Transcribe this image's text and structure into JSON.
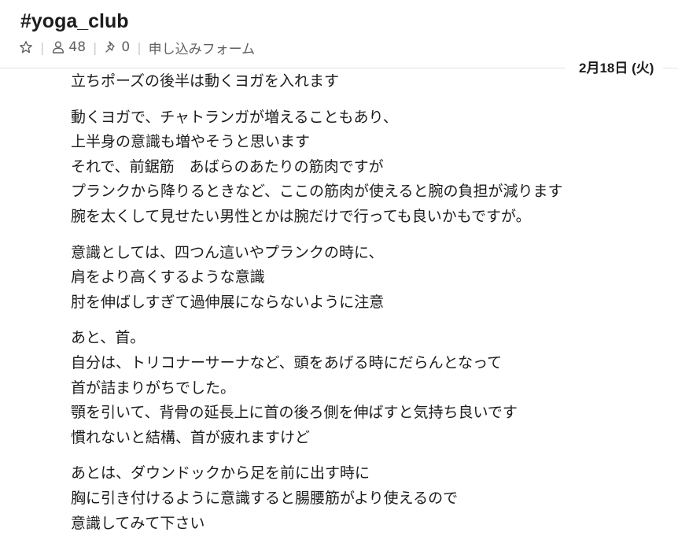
{
  "channel": {
    "title": "#yoga_club",
    "member_count": "48",
    "pinned_count": "0",
    "link_label": "申し込みフォーム"
  },
  "divider": {
    "date_label": "2月18日 (火)"
  },
  "message": {
    "paragraphs": [
      [
        "立ちポーズの後半は動くヨガを入れます"
      ],
      [
        "動くヨガで、チャトランガが増えることもあり、",
        "上半身の意識も増やそうと思います",
        "それで、前鋸筋　あばらのあたりの筋肉ですが",
        "プランクから降りるときなど、ここの筋肉が使えると腕の負担が減ります",
        "腕を太くして見せたい男性とかは腕だけで行っても良いかもですが。"
      ],
      [
        "意識としては、四つん這いやプランクの時に、",
        "肩をより高くするような意識",
        "肘を伸ばしすぎて過伸展にならないように注意"
      ],
      [
        "あと、首。",
        "自分は、トリコナーサーナなど、頭をあげる時にだらんとなって",
        "首が詰まりがちでした。",
        "顎を引いて、背骨の延長上に首の後ろ側を伸ばすと気持ち良いです",
        "慣れないと結構、首が疲れますけど"
      ],
      [
        "あとは、ダウンドックから足を前に出す時に",
        "胸に引き付けるように意識すると腸腰筋がより使えるので",
        "意識してみて下さい"
      ]
    ]
  },
  "colors": {
    "text": "#1d1c1d",
    "muted": "#616061",
    "divider": "#e4e4e4"
  },
  "icons": {
    "star": "star-icon",
    "members": "person-icon",
    "pin": "pin-icon"
  }
}
